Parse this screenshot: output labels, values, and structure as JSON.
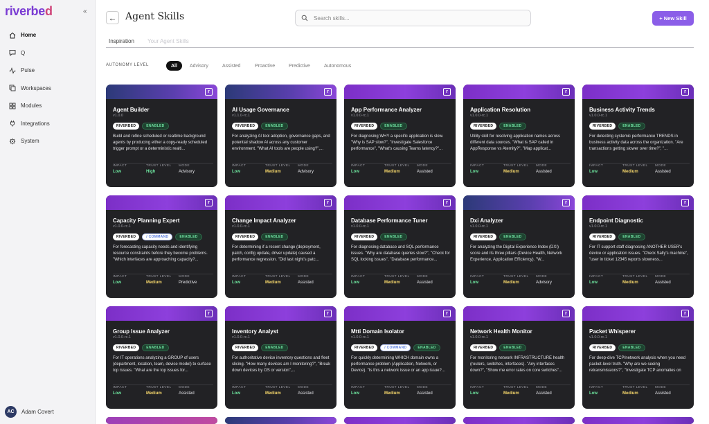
{
  "app": {
    "logo_main": "riverbe",
    "logo_tail": "d",
    "collapse_glyph": "«"
  },
  "sidebar": {
    "items": [
      {
        "label": "Home",
        "icon": "home-icon"
      },
      {
        "label": "Q",
        "icon": "chat-icon"
      },
      {
        "label": "Pulse",
        "icon": "pulse-icon"
      },
      {
        "label": "Workspaces",
        "icon": "workspaces-icon"
      },
      {
        "label": "Modules",
        "icon": "modules-icon"
      },
      {
        "label": "Integrations",
        "icon": "plug-icon"
      },
      {
        "label": "System",
        "icon": "gear-icon"
      }
    ],
    "user": {
      "initials": "AC",
      "name": "Adam Covert"
    }
  },
  "header": {
    "back_glyph": "←",
    "title": "Agent Skills",
    "search_placeholder": "Search skills...",
    "new_button": "+ New Skill"
  },
  "tabs": [
    "Inspiration",
    "Your Agent Skills"
  ],
  "filters": {
    "label": "AUTONOMY LEVEL",
    "options": [
      "All",
      "Advisory",
      "Assisted",
      "Proactive",
      "Predictive",
      "Autonomous"
    ],
    "selected": "All"
  },
  "metric_labels": {
    "impact": "IMPACT",
    "trust": "TRUST LEVEL",
    "mode": "MODE"
  },
  "badges": {
    "riverbed": "RIVERBED",
    "command": "/ COMMAND",
    "enabled": "ENABLED"
  },
  "r_glyph": "r",
  "cards": [
    {
      "title": "Agent Builder",
      "version": "v1.0.0",
      "command": false,
      "desc": "Build and refine scheduled or realtime background agents by producing either a copy-ready scheduled trigger prompt or a deterministic realti...",
      "impact": "Low",
      "trust": "High",
      "mode": "Advisory"
    },
    {
      "title": "AI Usage Governance",
      "version": "v1.1.0-rc.1",
      "command": false,
      "desc": "For analyzing AI tool adoption, governance gaps, and potential shadow AI across any customer environment. \"What AI tools are people using?\",...",
      "impact": "Low",
      "trust": "Medium",
      "mode": "Advisory"
    },
    {
      "title": "App Performance Analyzer",
      "version": "v1.0.0-rc.1",
      "command": false,
      "desc": "For diagnosing WHY a specific application is slow. \"Why is SAP slow?\", \"Investigate Salesforce performance\", \"What's causing Teams latency?\"...",
      "impact": "Low",
      "trust": "Medium",
      "mode": "Assisted"
    },
    {
      "title": "Application Resolution",
      "version": "v1.0.0-rc.1",
      "command": false,
      "desc": "Utility skill for resolving application names across different data sources. \"What is SAP called in AppResponse vs Aternity?\", \"Map applicat...",
      "impact": "Low",
      "trust": "Medium",
      "mode": "Assisted"
    },
    {
      "title": "Business Activity Trends",
      "version": "v1.0.0-rc.1",
      "command": false,
      "desc": "For detecting systemic performance TRENDS in business activity data across the organization. \"Are transactions getting slower over time?\", \"...",
      "impact": "Low",
      "trust": "Medium",
      "mode": "Assisted"
    },
    {
      "title": "Capacity Planning Expert",
      "version": "v1.0.0-rc.1",
      "command": true,
      "desc": "For forecasting capacity needs and identifying resource constraints before they become problems. \"Which interfaces are approaching capacity?...",
      "impact": "Low",
      "trust": "Medium",
      "mode": "Predictive"
    },
    {
      "title": "Change Impact Analyzer",
      "version": "v1.0.0-rc.1",
      "command": false,
      "desc": "For determining if a recent change (deployment, patch, config update, driver update) caused a performance regression. \"Did last night's patc...",
      "impact": "Low",
      "trust": "Medium",
      "mode": "Assisted"
    },
    {
      "title": "Database Performance Tuner",
      "version": "v1.0.0-rc.1",
      "command": false,
      "desc": "For diagnosing database and SQL performance issues. \"Why are database queries slow?\", \"Check for SQL locking issues\", \"Database performance...",
      "impact": "Low",
      "trust": "Medium",
      "mode": "Assisted"
    },
    {
      "title": "Dxi Analyzer",
      "version": "v1.0.0-rc.1",
      "command": false,
      "desc": "For analyzing the Digital Experience Index (DXI) score and its three pillars (Device Health, Network Experience, Application Efficiency). \"W...",
      "impact": "Low",
      "trust": "Medium",
      "mode": "Advisory"
    },
    {
      "title": "Endpoint Diagnostic",
      "version": "v1.0.0-rc.1",
      "command": false,
      "desc": "For IT support staff diagnosing ANOTHER USER's device or application issues. \"Check Sally's machine\", \"user in ticket 12345 reports slowness...",
      "impact": "Low",
      "trust": "Medium",
      "mode": "Assisted"
    },
    {
      "title": "Group Issue Analyzer",
      "version": "v1.0.0-rc.1",
      "command": false,
      "desc": "For IT operations analyzing a GROUP of users (department, location, team, device model) to surface top issues. \"What are the top issues for...",
      "impact": "Low",
      "trust": "Medium",
      "mode": "Assisted"
    },
    {
      "title": "Inventory Analyst",
      "version": "v1.0.0-rc.1",
      "command": false,
      "desc": "For authoritative device inventory questions and fleet slicing. \"How many devices am I monitoring?\", \"Break down devices by OS or version\",...",
      "impact": "Low",
      "trust": "Medium",
      "mode": "Assisted"
    },
    {
      "title": "Mtti Domain Isolator",
      "version": "v1.0.0-rc.1",
      "command": true,
      "desc": "For quickly determining WHICH domain owns a performance problem (Application, Network, or Device). \"Is this a network issue or an app issue?...",
      "impact": "Low",
      "trust": "Medium",
      "mode": "Assisted"
    },
    {
      "title": "Network Health Monitor",
      "version": "v1.0.0-rc.1",
      "command": false,
      "desc": "For monitoring network INFRASTRUCTURE health (routers, switches, interfaces). \"Any interfaces down?\", \"Show me error rates on core switches\"...",
      "impact": "Low",
      "trust": "Medium",
      "mode": "Assisted"
    },
    {
      "title": "Packet Whisperer",
      "version": "v1.0.0-rc.1",
      "command": false,
      "desc": "For deep-dive TCP/network analysis when you need packet-level truth. \"Why are we seeing retransmissions?\", \"Investigate TCP anomalies on thi...",
      "impact": "Low",
      "trust": "Medium",
      "mode": "Assisted"
    }
  ]
}
